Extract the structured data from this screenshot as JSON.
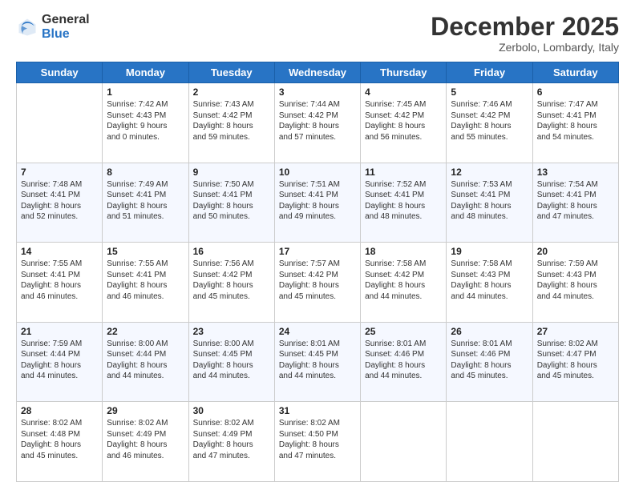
{
  "header": {
    "logo_general": "General",
    "logo_blue": "Blue",
    "month": "December 2025",
    "location": "Zerbolo, Lombardy, Italy"
  },
  "days_of_week": [
    "Sunday",
    "Monday",
    "Tuesday",
    "Wednesday",
    "Thursday",
    "Friday",
    "Saturday"
  ],
  "weeks": [
    [
      {
        "day": "",
        "text": ""
      },
      {
        "day": "1",
        "text": "Sunrise: 7:42 AM\nSunset: 4:43 PM\nDaylight: 9 hours\nand 0 minutes."
      },
      {
        "day": "2",
        "text": "Sunrise: 7:43 AM\nSunset: 4:42 PM\nDaylight: 8 hours\nand 59 minutes."
      },
      {
        "day": "3",
        "text": "Sunrise: 7:44 AM\nSunset: 4:42 PM\nDaylight: 8 hours\nand 57 minutes."
      },
      {
        "day": "4",
        "text": "Sunrise: 7:45 AM\nSunset: 4:42 PM\nDaylight: 8 hours\nand 56 minutes."
      },
      {
        "day": "5",
        "text": "Sunrise: 7:46 AM\nSunset: 4:42 PM\nDaylight: 8 hours\nand 55 minutes."
      },
      {
        "day": "6",
        "text": "Sunrise: 7:47 AM\nSunset: 4:41 PM\nDaylight: 8 hours\nand 54 minutes."
      }
    ],
    [
      {
        "day": "7",
        "text": "Sunrise: 7:48 AM\nSunset: 4:41 PM\nDaylight: 8 hours\nand 52 minutes."
      },
      {
        "day": "8",
        "text": "Sunrise: 7:49 AM\nSunset: 4:41 PM\nDaylight: 8 hours\nand 51 minutes."
      },
      {
        "day": "9",
        "text": "Sunrise: 7:50 AM\nSunset: 4:41 PM\nDaylight: 8 hours\nand 50 minutes."
      },
      {
        "day": "10",
        "text": "Sunrise: 7:51 AM\nSunset: 4:41 PM\nDaylight: 8 hours\nand 49 minutes."
      },
      {
        "day": "11",
        "text": "Sunrise: 7:52 AM\nSunset: 4:41 PM\nDaylight: 8 hours\nand 48 minutes."
      },
      {
        "day": "12",
        "text": "Sunrise: 7:53 AM\nSunset: 4:41 PM\nDaylight: 8 hours\nand 48 minutes."
      },
      {
        "day": "13",
        "text": "Sunrise: 7:54 AM\nSunset: 4:41 PM\nDaylight: 8 hours\nand 47 minutes."
      }
    ],
    [
      {
        "day": "14",
        "text": "Sunrise: 7:55 AM\nSunset: 4:41 PM\nDaylight: 8 hours\nand 46 minutes."
      },
      {
        "day": "15",
        "text": "Sunrise: 7:55 AM\nSunset: 4:41 PM\nDaylight: 8 hours\nand 46 minutes."
      },
      {
        "day": "16",
        "text": "Sunrise: 7:56 AM\nSunset: 4:42 PM\nDaylight: 8 hours\nand 45 minutes."
      },
      {
        "day": "17",
        "text": "Sunrise: 7:57 AM\nSunset: 4:42 PM\nDaylight: 8 hours\nand 45 minutes."
      },
      {
        "day": "18",
        "text": "Sunrise: 7:58 AM\nSunset: 4:42 PM\nDaylight: 8 hours\nand 44 minutes."
      },
      {
        "day": "19",
        "text": "Sunrise: 7:58 AM\nSunset: 4:43 PM\nDaylight: 8 hours\nand 44 minutes."
      },
      {
        "day": "20",
        "text": "Sunrise: 7:59 AM\nSunset: 4:43 PM\nDaylight: 8 hours\nand 44 minutes."
      }
    ],
    [
      {
        "day": "21",
        "text": "Sunrise: 7:59 AM\nSunset: 4:44 PM\nDaylight: 8 hours\nand 44 minutes."
      },
      {
        "day": "22",
        "text": "Sunrise: 8:00 AM\nSunset: 4:44 PM\nDaylight: 8 hours\nand 44 minutes."
      },
      {
        "day": "23",
        "text": "Sunrise: 8:00 AM\nSunset: 4:45 PM\nDaylight: 8 hours\nand 44 minutes."
      },
      {
        "day": "24",
        "text": "Sunrise: 8:01 AM\nSunset: 4:45 PM\nDaylight: 8 hours\nand 44 minutes."
      },
      {
        "day": "25",
        "text": "Sunrise: 8:01 AM\nSunset: 4:46 PM\nDaylight: 8 hours\nand 44 minutes."
      },
      {
        "day": "26",
        "text": "Sunrise: 8:01 AM\nSunset: 4:46 PM\nDaylight: 8 hours\nand 45 minutes."
      },
      {
        "day": "27",
        "text": "Sunrise: 8:02 AM\nSunset: 4:47 PM\nDaylight: 8 hours\nand 45 minutes."
      }
    ],
    [
      {
        "day": "28",
        "text": "Sunrise: 8:02 AM\nSunset: 4:48 PM\nDaylight: 8 hours\nand 45 minutes."
      },
      {
        "day": "29",
        "text": "Sunrise: 8:02 AM\nSunset: 4:49 PM\nDaylight: 8 hours\nand 46 minutes."
      },
      {
        "day": "30",
        "text": "Sunrise: 8:02 AM\nSunset: 4:49 PM\nDaylight: 8 hours\nand 47 minutes."
      },
      {
        "day": "31",
        "text": "Sunrise: 8:02 AM\nSunset: 4:50 PM\nDaylight: 8 hours\nand 47 minutes."
      },
      {
        "day": "",
        "text": ""
      },
      {
        "day": "",
        "text": ""
      },
      {
        "day": "",
        "text": ""
      }
    ]
  ]
}
